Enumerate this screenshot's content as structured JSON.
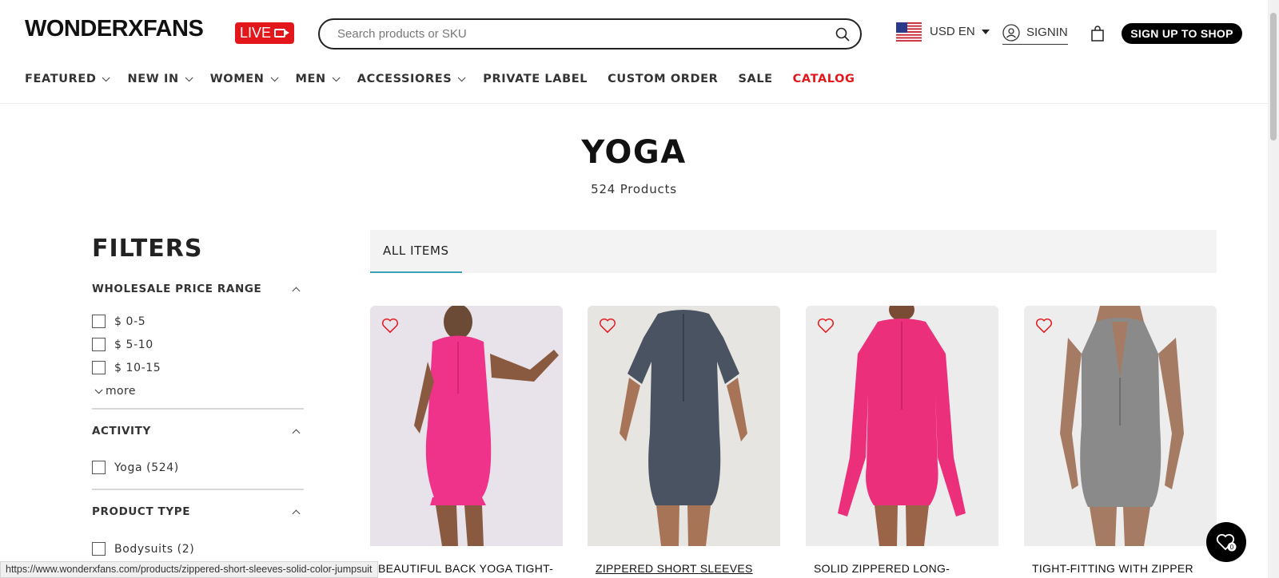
{
  "header": {
    "logo": "WONDERXFANS",
    "live_label": "LIVE",
    "search_placeholder": "Search products or SKU",
    "currency": "USD EN",
    "signin": "SIGNIN",
    "signup": "SIGN UP TO SHOP"
  },
  "nav": [
    {
      "label": "FEATURED",
      "dropdown": true
    },
    {
      "label": "NEW IN",
      "dropdown": true
    },
    {
      "label": "WOMEN",
      "dropdown": true
    },
    {
      "label": "MEN",
      "dropdown": true
    },
    {
      "label": "ACCESSIORES",
      "dropdown": true
    },
    {
      "label": "PRIVATE LABEL",
      "dropdown": false
    },
    {
      "label": "CUSTOM ORDER",
      "dropdown": false
    },
    {
      "label": "SALE",
      "dropdown": false
    },
    {
      "label": "CATALOG",
      "dropdown": false,
      "color": "#e3161b"
    }
  ],
  "page": {
    "title": "YOGA",
    "count": "524 Products"
  },
  "filters": {
    "title": "FILTERS",
    "price": {
      "title": "WHOLESALE PRICE RANGE",
      "options": [
        "$ 0-5",
        "$ 5-10",
        "$ 10-15"
      ],
      "more": "more"
    },
    "activity": {
      "title": "ACTIVITY",
      "options": [
        "Yoga (524)"
      ]
    },
    "product_type": {
      "title": "PRODUCT TYPE",
      "options": [
        "Bodysuits (2)"
      ]
    }
  },
  "tabs": {
    "all_items": "ALL ITEMS"
  },
  "products": [
    {
      "name": "BEAUTIFUL BACK YOGA TIGHT-FITTING EXERCISE",
      "color": "#f0338a",
      "bg": "#e8e3ea"
    },
    {
      "name": "ZIPPERED SHORT SLEEVES SOLID COLOR JUMPSUIT",
      "color": "#4a5361",
      "bg": "#e7e5e2"
    },
    {
      "name": "SOLID ZIPPERED LONG-SLEEVED SPORTS JUMPSUIT",
      "color": "#ec2f7a",
      "bg": "#ececec"
    },
    {
      "name": "TIGHT-FITTING WITH ZIPPER QUICK-DRYING JUMPSUIT",
      "color": "#8a8a8a",
      "bg": "#ededed"
    }
  ],
  "colors": {
    "accent_red": "#e3161b",
    "tab_underline": "#3aa0b5",
    "heart": "#e3161b"
  },
  "wishlist_count": "0",
  "status_bar_url": "https://www.wonderxfans.com/products/zippered-short-sleeves-solid-color-jumpsuit"
}
